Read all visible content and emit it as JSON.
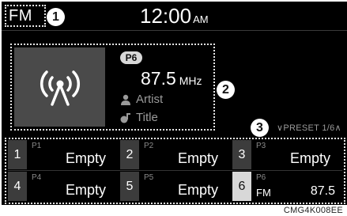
{
  "header": {
    "mode": "FM",
    "time": "12:00",
    "ampm": "AM"
  },
  "callouts": [
    "1",
    "2",
    "3"
  ],
  "now_playing": {
    "preset_badge": "P6",
    "frequency": "87.5",
    "unit": "MHz",
    "artist": "Artist",
    "title": "Title",
    "icons": [
      "radio-antenna-icon",
      "person-icon",
      "music-note-icon"
    ]
  },
  "preset_nav": {
    "label": "PRESET 1/6",
    "icons": [
      "chevron-down-icon",
      "chevron-up-icon"
    ]
  },
  "presets": [
    {
      "num": "1",
      "pn": "P1",
      "name": "Empty"
    },
    {
      "num": "2",
      "pn": "P2",
      "name": "Empty"
    },
    {
      "num": "3",
      "pn": "P3",
      "name": "Empty"
    },
    {
      "num": "4",
      "pn": "P4",
      "name": "Empty"
    },
    {
      "num": "5",
      "pn": "P5",
      "name": "Empty"
    },
    {
      "num": "6",
      "pn": "P6",
      "band": "FM",
      "freq": "87.5"
    }
  ],
  "caption": "CMG4K008EE",
  "colors": {
    "background": "#000000",
    "panel": "#4a4a4a",
    "badge": "#d8d8d8",
    "muted_text": "#9a9a9a"
  }
}
